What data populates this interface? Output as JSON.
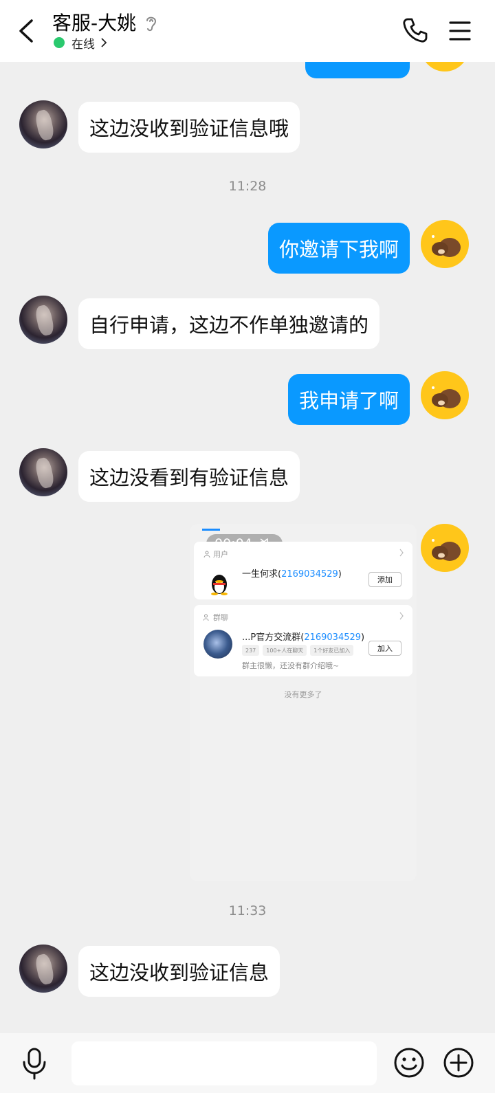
{
  "header": {
    "title": "客服-大姚",
    "status": "在线",
    "status_color": "#2ac96e"
  },
  "messages": [
    {
      "from": "agent",
      "text": "这边没收到验证信息哦"
    },
    {
      "type": "time",
      "text": "11:28"
    },
    {
      "from": "me",
      "text": "你邀请下我啊"
    },
    {
      "from": "agent",
      "text": "自行申请，这边不作单独邀请的"
    },
    {
      "from": "me",
      "text": "我申请了啊"
    },
    {
      "from": "agent",
      "text": "这边没看到有验证信息"
    },
    {
      "from": "me",
      "type": "video",
      "duration": "00:04"
    },
    {
      "type": "time",
      "text": "11:33"
    },
    {
      "from": "agent",
      "text": "这边没收到验证信息"
    }
  ],
  "video": {
    "duration": "00:04",
    "user_section": "用户",
    "user_name": "一生何求(",
    "user_number": "2169034529",
    "user_close": ")",
    "user_button": "添加",
    "group_section": "群聊",
    "group_name": "...P官方交流群(",
    "group_number": "2169034529",
    "group_close": ")",
    "group_tags": [
      "237",
      "100+人在聊天",
      "1个好友已加入"
    ],
    "group_desc": "群主很懒，还没有群介绍哦~",
    "group_button": "加入",
    "no_more": "没有更多了"
  },
  "input": {
    "value": ""
  },
  "colors": {
    "bubble_out": "#0a99ff",
    "bubble_in": "#ffffff",
    "background": "#efefef",
    "link": "#1a8cff"
  },
  "icons": [
    "back-arrow-icon",
    "ear-icon",
    "chevron-right-icon",
    "phone-icon",
    "menu-icon",
    "mute-icon",
    "mic-icon",
    "emoji-icon",
    "plus-icon"
  ]
}
